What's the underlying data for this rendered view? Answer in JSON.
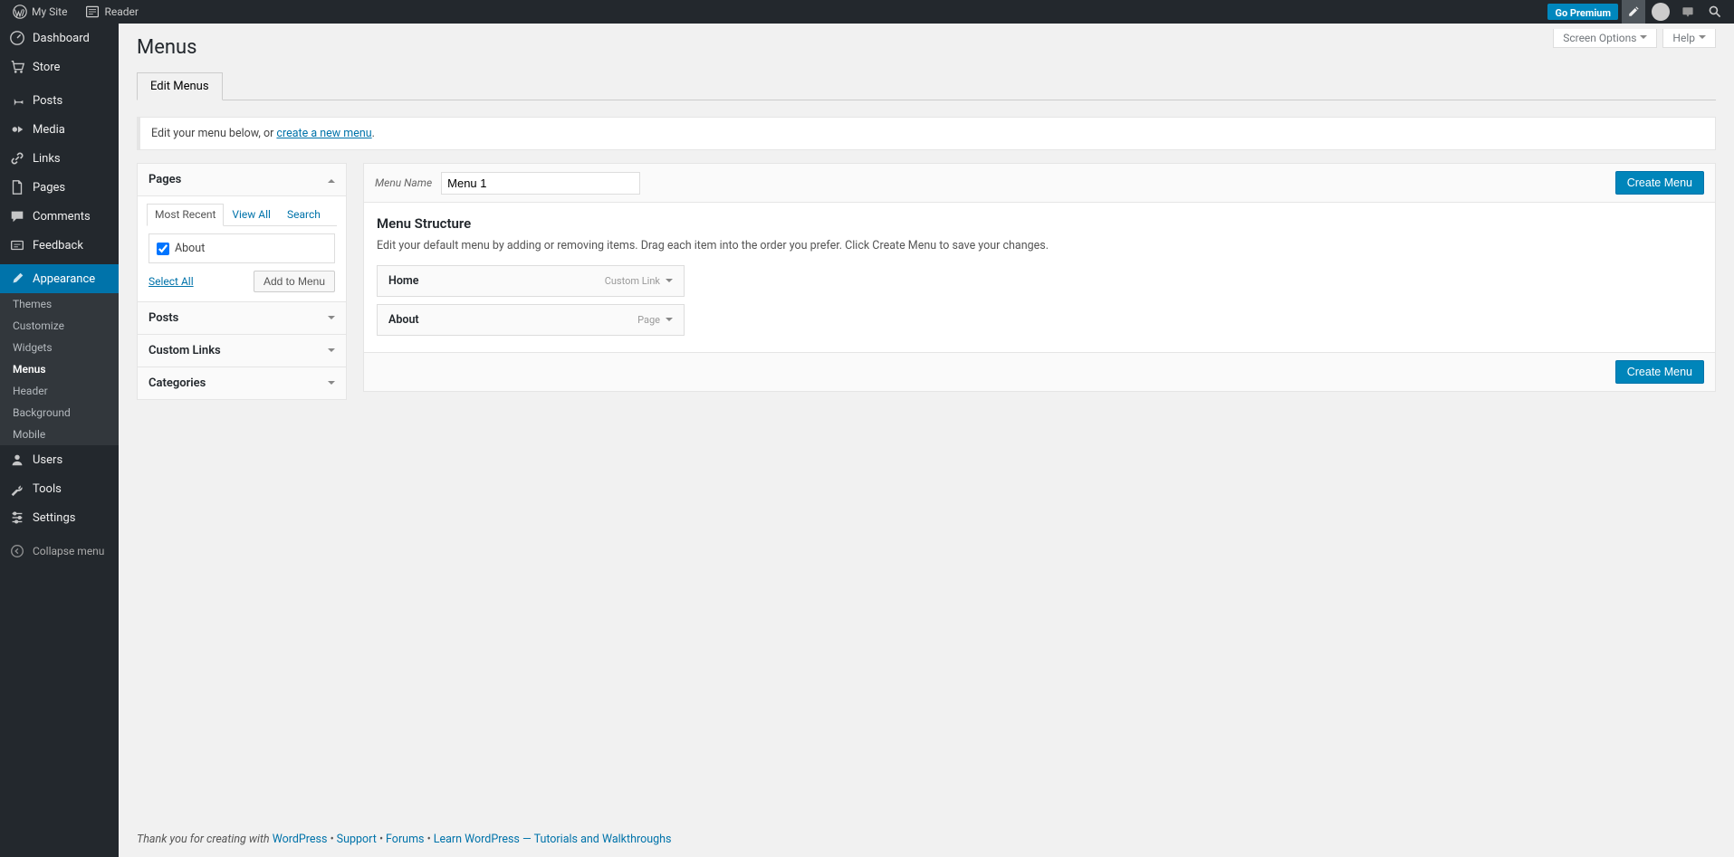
{
  "adminbar": {
    "mysite": "My Site",
    "reader": "Reader",
    "go_premium": "Go Premium"
  },
  "sidebar": {
    "items": [
      {
        "icon": "dashboard",
        "label": "Dashboard"
      },
      {
        "icon": "cart",
        "label": "Store"
      },
      {
        "gap": true
      },
      {
        "icon": "pin",
        "label": "Posts"
      },
      {
        "icon": "media",
        "label": "Media"
      },
      {
        "icon": "link",
        "label": "Links"
      },
      {
        "icon": "page",
        "label": "Pages"
      },
      {
        "icon": "comment",
        "label": "Comments"
      },
      {
        "icon": "feedback",
        "label": "Feedback"
      },
      {
        "gap": true
      },
      {
        "icon": "brush",
        "label": "Appearance",
        "current": true
      },
      {
        "icon": "user",
        "label": "Users"
      },
      {
        "icon": "wrench",
        "label": "Tools"
      },
      {
        "icon": "settings",
        "label": "Settings"
      },
      {
        "gap": true
      },
      {
        "icon": "collapse",
        "label": "Collapse menu",
        "collapse": true
      }
    ],
    "appearance_submenu": [
      {
        "label": "Themes"
      },
      {
        "label": "Customize"
      },
      {
        "label": "Widgets"
      },
      {
        "label": "Menus",
        "current": true
      },
      {
        "label": "Header"
      },
      {
        "label": "Background"
      },
      {
        "label": "Mobile"
      }
    ]
  },
  "screen_meta": {
    "screen_options": "Screen Options",
    "help": "Help"
  },
  "page": {
    "title": "Menus",
    "tab_edit": "Edit Menus",
    "notice_prefix": "Edit your menu below, or ",
    "notice_link": "create a new menu",
    "notice_suffix": "."
  },
  "settings_column": {
    "panels": [
      {
        "title": "Pages",
        "open": true
      },
      {
        "title": "Posts",
        "open": false
      },
      {
        "title": "Custom Links",
        "open": false
      },
      {
        "title": "Categories",
        "open": false
      }
    ],
    "pages_tabs": {
      "recent": "Most Recent",
      "viewall": "View All",
      "search": "Search"
    },
    "pages_items": [
      {
        "label": "About",
        "checked": true
      }
    ],
    "select_all": "Select All",
    "add_to_menu": "Add to Menu"
  },
  "menu_edit": {
    "menu_name_label": "Menu Name",
    "menu_name_value": "Menu 1",
    "create_menu": "Create Menu",
    "structure_title": "Menu Structure",
    "structure_desc": "Edit your default menu by adding or removing items. Drag each item into the order you prefer. Click Create Menu to save your changes.",
    "items": [
      {
        "title": "Home",
        "type": "Custom Link"
      },
      {
        "title": "About",
        "type": "Page"
      }
    ]
  },
  "footer": {
    "prefix": "Thank you for creating with ",
    "wp": "WordPress",
    "sep": " • ",
    "support": "Support",
    "forums": "Forums",
    "learn": "Learn WordPress — Tutorials and Walkthroughs"
  }
}
